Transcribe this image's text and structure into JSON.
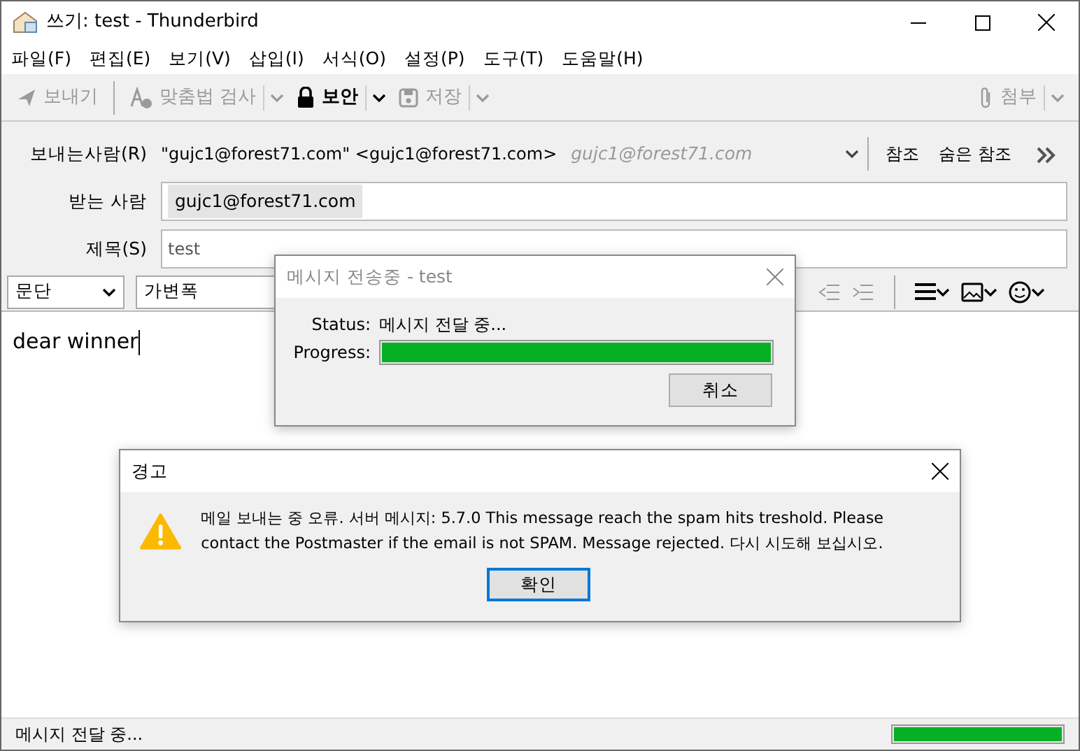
{
  "window": {
    "title": "쓰기: test - Thunderbird"
  },
  "menu": [
    "파일(F)",
    "편집(E)",
    "보기(V)",
    "삽입(I)",
    "서식(O)",
    "설정(P)",
    "도구(T)",
    "도움말(H)"
  ],
  "toolbar": [
    {
      "kind": "send",
      "label": "보내기",
      "disabled": true,
      "dropdown": false
    },
    {
      "kind": "spell",
      "label": "맞춤법 검사",
      "disabled": true,
      "dropdown": true
    },
    {
      "kind": "security",
      "label": "보안",
      "disabled": false,
      "dropdown": true
    },
    {
      "kind": "save",
      "label": "저장",
      "disabled": true,
      "dropdown": true
    }
  ],
  "attach": {
    "label": "첨부",
    "disabled": true
  },
  "header": {
    "from": {
      "label": "보내는사람(R)",
      "name": "\"gujc1@forest71.com\"",
      "address": "<gujc1@forest71.com>",
      "identity": "gujc1@forest71.com"
    },
    "cc": "참조",
    "bcc": "숨은 참조",
    "to": {
      "label": "받는 사람",
      "recipients": [
        "gujc1@forest71.com"
      ]
    },
    "subject": {
      "label": "제목(S)",
      "value": "test"
    }
  },
  "format_bar": {
    "paragraph": "문단",
    "font": "가변폭"
  },
  "body": {
    "text": "dear winner"
  },
  "progress_dialog": {
    "title": "메시지 전송중 - test",
    "status_label": "Status:",
    "status": "메시지 전달 중...",
    "progress_label": "Progress:",
    "level": 1.0,
    "cancel": "취소"
  },
  "alert": {
    "title": "경고",
    "message": "메일 보내는 중 오류. 서버 메시지: 5.7.0 This message reach the spam hits treshold. Please contact the Postmaster if the email is not SPAM. Message rejected. 다시 시도해 보십시오.",
    "ok": "확인"
  },
  "status_bar": {
    "text": "메시지 전달 중...",
    "level": 1.0
  }
}
